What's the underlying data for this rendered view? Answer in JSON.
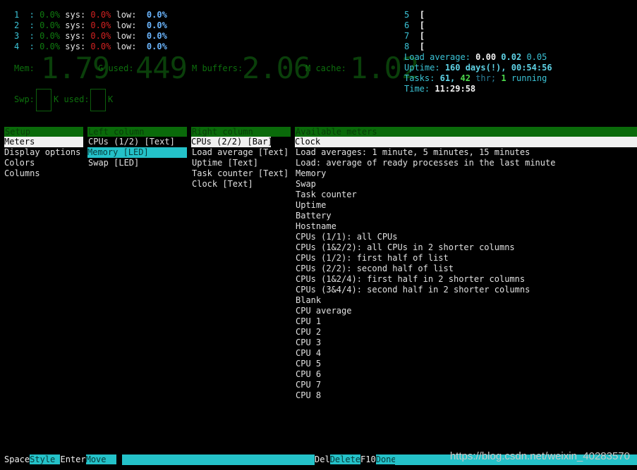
{
  "cpus_left": [
    {
      "num": "1",
      "user": "0.0%",
      "sys_label": "sys:",
      "sys": "0.0%",
      "low_label": "low:",
      "low": "0.0%"
    },
    {
      "num": "2",
      "user": "0.0%",
      "sys_label": "sys:",
      "sys": "0.0%",
      "low_label": "low:",
      "low": "0.0%"
    },
    {
      "num": "3",
      "user": "0.0%",
      "sys_label": "sys:",
      "sys": "0.0%",
      "low_label": "low:",
      "low": "0.0%"
    },
    {
      "num": "4",
      "user": "0.0%",
      "sys_label": "sys:",
      "sys": "0.0%",
      "low_label": "low:",
      "low": "0.0%"
    }
  ],
  "cpus_right": [
    {
      "num": "5",
      "bracket": "["
    },
    {
      "num": "6",
      "bracket": "["
    },
    {
      "num": "7",
      "bracket": "["
    },
    {
      "num": "8",
      "bracket": "["
    }
  ],
  "memory": {
    "mem_label": "Mem:",
    "mem_total": "1.79",
    "used_label": "G used:",
    "used": "449",
    "buffers_label": "M buffers:",
    "buffers": "2.06",
    "cache_label": "M cache:",
    "cache": "1.02"
  },
  "swap": {
    "swp_label": "Swp:",
    "used_label": "K used:",
    "unit_label": "K"
  },
  "right_meters": {
    "load_label": "Load average:",
    "load1": "0.00",
    "load5": "0.02",
    "load15": "0.05",
    "uptime_label": "Uptime:",
    "uptime_days": "160 days(!),",
    "uptime_time": "00:54:56",
    "tasks_label": "Tasks:",
    "tasks": "61,",
    "thr": "42",
    "thr_label": "thr;",
    "running": "1",
    "running_label": "running",
    "time_label": "Time:",
    "time": "11:29:58"
  },
  "setup": {
    "header": "Setup",
    "items": [
      "Meters",
      "Display options",
      "Colors",
      "Columns"
    ]
  },
  "left_column": {
    "header": "Left column",
    "items": [
      "CPUs (1/2) [Text]",
      "Memory [LED]",
      "Swap [LED]"
    ]
  },
  "right_column": {
    "header": "Right column",
    "items": [
      "CPUs (2/2) [Bar]",
      "Load average [Text]",
      "Uptime [Text]",
      "Task counter [Text]",
      "Clock [Text]"
    ]
  },
  "available_meters": {
    "header": "Available meters",
    "items": [
      "Clock",
      "Load averages: 1 minute, 5 minutes, 15 minutes",
      "Load: average of ready processes in the last minute",
      "Memory",
      "Swap",
      "Task counter",
      "Uptime",
      "Battery",
      "Hostname",
      "CPUs (1/1): all CPUs",
      "CPUs (1&2/2): all CPUs in 2 shorter columns",
      "CPUs (1/2): first half of list",
      "CPUs (2/2): second half of list",
      "CPUs (1&2/4): first half in 2 shorter columns",
      "CPUs (3&4/4): second half in 2 shorter columns",
      "Blank",
      "CPU average",
      "CPU 1",
      "CPU 2",
      "CPU 3",
      "CPU 4",
      "CPU 5",
      "CPU 6",
      "CPU 7",
      "CPU 8"
    ]
  },
  "footer": {
    "space": "Space",
    "style": "Style ",
    "enter": "Enter",
    "move": "Move  ",
    "del": "Del",
    "delete": "Delete",
    "f10": "F10",
    "done": "Done"
  },
  "watermark": "https://blog.csdn.net/weixin_40283570"
}
